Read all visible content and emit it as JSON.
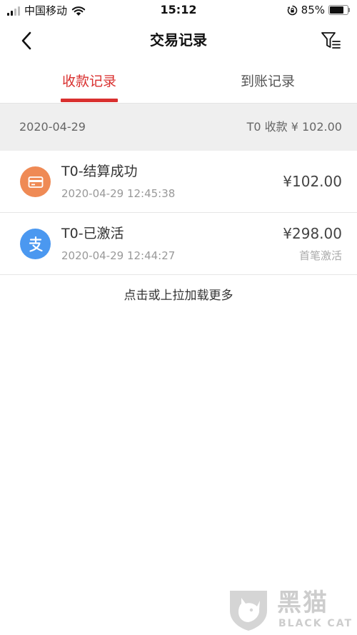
{
  "status_bar": {
    "carrier": "中国移动",
    "time": "15:12",
    "battery_percent": "85%",
    "battery_level": 0.85,
    "icons": [
      "signal-icon",
      "wifi-icon",
      "orientation-lock-icon",
      "battery-icon"
    ]
  },
  "nav": {
    "title": "交易记录",
    "icons": [
      "back-arrow-icon",
      "filter-icon"
    ]
  },
  "tabs": [
    {
      "label": "收款记录",
      "active": true
    },
    {
      "label": "到账记录",
      "active": false
    }
  ],
  "summary": {
    "date": "2020-04-29",
    "total": "T0 收款 ¥ 102.00"
  },
  "records": [
    {
      "title": "T0-结算成功",
      "time": "2020-04-29 12:45:38",
      "amount": "¥102.00",
      "note": "",
      "icon": "card-icon",
      "icon_color": "#ef8a55"
    },
    {
      "title": "T0-已激活",
      "time": "2020-04-29 12:44:27",
      "amount": "¥298.00",
      "note": "首笔激活",
      "icon": "alipay-icon",
      "icon_color": "#4b98f0"
    }
  ],
  "load_more": "点击或上拉加载更多",
  "watermark": {
    "main": "黑猫",
    "sub": "BLACK CAT"
  },
  "colors": {
    "accent": "#d9302f",
    "summary_bg": "#efefef"
  }
}
